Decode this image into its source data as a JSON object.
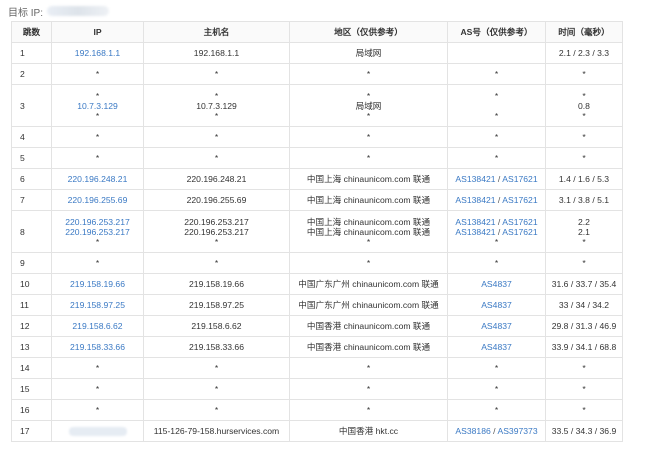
{
  "target": {
    "label": "目标 IP:"
  },
  "columns": [
    "跳数",
    "IP",
    "主机名",
    "地区（仅供参考）",
    "AS号（仅供参考）",
    "时间（毫秒）"
  ],
  "rows": [
    {
      "hop": "1",
      "ips": [
        "192.168.1.1"
      ],
      "hosts": [
        "192.168.1.1"
      ],
      "regions": [
        "局域网"
      ],
      "as": [
        []
      ],
      "times": [
        "2.1 / 2.3 / 3.3"
      ]
    },
    {
      "hop": "2",
      "ips": [
        "*"
      ],
      "hosts": [
        "*"
      ],
      "regions": [
        "*"
      ],
      "as": [
        [
          "*"
        ]
      ],
      "times": [
        "*"
      ]
    },
    {
      "hop": "3",
      "ips": [
        "*",
        "10.7.3.129",
        "*"
      ],
      "hosts": [
        "*",
        "10.7.3.129",
        "*"
      ],
      "regions": [
        "*",
        "局域网",
        "*"
      ],
      "as": [
        [
          "*"
        ],
        [],
        [
          "*"
        ]
      ],
      "times": [
        "*",
        "0.8",
        "*"
      ]
    },
    {
      "hop": "4",
      "ips": [
        "*"
      ],
      "hosts": [
        "*"
      ],
      "regions": [
        "*"
      ],
      "as": [
        [
          "*"
        ]
      ],
      "times": [
        "*"
      ]
    },
    {
      "hop": "5",
      "ips": [
        "*"
      ],
      "hosts": [
        "*"
      ],
      "regions": [
        "*"
      ],
      "as": [
        [
          "*"
        ]
      ],
      "times": [
        "*"
      ]
    },
    {
      "hop": "6",
      "ips": [
        "220.196.248.21"
      ],
      "hosts": [
        "220.196.248.21"
      ],
      "regions": [
        "中国上海 chinaunicom.com 联通"
      ],
      "as": [
        [
          "AS138421",
          "AS17621"
        ]
      ],
      "times": [
        "1.4 / 1.6 / 5.3"
      ]
    },
    {
      "hop": "7",
      "ips": [
        "220.196.255.69"
      ],
      "hosts": [
        "220.196.255.69"
      ],
      "regions": [
        "中国上海 chinaunicom.com 联通"
      ],
      "as": [
        [
          "AS138421",
          "AS17621"
        ]
      ],
      "times": [
        "3.1 / 3.8 / 5.1"
      ]
    },
    {
      "hop": "8",
      "ips": [
        "220.196.253.217",
        "220.196.253.217",
        "*"
      ],
      "hosts": [
        "220.196.253.217",
        "220.196.253.217",
        "*"
      ],
      "regions": [
        "中国上海 chinaunicom.com 联通",
        "中国上海 chinaunicom.com 联通",
        "*"
      ],
      "as": [
        [
          "AS138421",
          "AS17621"
        ],
        [
          "AS138421",
          "AS17621"
        ],
        [
          "*"
        ]
      ],
      "times": [
        "2.2",
        "2.1",
        "*"
      ]
    },
    {
      "hop": "9",
      "ips": [
        "*"
      ],
      "hosts": [
        "*"
      ],
      "regions": [
        "*"
      ],
      "as": [
        [
          "*"
        ]
      ],
      "times": [
        "*"
      ]
    },
    {
      "hop": "10",
      "ips": [
        "219.158.19.66"
      ],
      "hosts": [
        "219.158.19.66"
      ],
      "regions": [
        "中国广东广州 chinaunicom.com 联通"
      ],
      "as": [
        [
          "AS4837"
        ]
      ],
      "times": [
        "31.6 / 33.7 / 35.4"
      ]
    },
    {
      "hop": "11",
      "ips": [
        "219.158.97.25"
      ],
      "hosts": [
        "219.158.97.25"
      ],
      "regions": [
        "中国广东广州 chinaunicom.com 联通"
      ],
      "as": [
        [
          "AS4837"
        ]
      ],
      "times": [
        "33 / 34 / 34.2"
      ]
    },
    {
      "hop": "12",
      "ips": [
        "219.158.6.62"
      ],
      "hosts": [
        "219.158.6.62"
      ],
      "regions": [
        "中国香港 chinaunicom.com 联通"
      ],
      "as": [
        [
          "AS4837"
        ]
      ],
      "times": [
        "29.8 / 31.3 / 46.9"
      ]
    },
    {
      "hop": "13",
      "ips": [
        "219.158.33.66"
      ],
      "hosts": [
        "219.158.33.66"
      ],
      "regions": [
        "中国香港 chinaunicom.com 联通"
      ],
      "as": [
        [
          "AS4837"
        ]
      ],
      "times": [
        "33.9 / 34.1 / 68.8"
      ]
    },
    {
      "hop": "14",
      "ips": [
        "*"
      ],
      "hosts": [
        "*"
      ],
      "regions": [
        "*"
      ],
      "as": [
        [
          "*"
        ]
      ],
      "times": [
        "*"
      ]
    },
    {
      "hop": "15",
      "ips": [
        "*"
      ],
      "hosts": [
        "*"
      ],
      "regions": [
        "*"
      ],
      "as": [
        [
          "*"
        ]
      ],
      "times": [
        "*"
      ]
    },
    {
      "hop": "16",
      "ips": [
        "*"
      ],
      "hosts": [
        "*"
      ],
      "regions": [
        "*"
      ],
      "as": [
        [
          "*"
        ]
      ],
      "times": [
        "*"
      ]
    },
    {
      "hop": "17",
      "ips": [
        ""
      ],
      "hosts": [
        "115-126-79-158.hurservices.com"
      ],
      "regions": [
        "中国香港 hkt.cc"
      ],
      "as": [
        [
          "AS38186",
          "AS397373"
        ]
      ],
      "times": [
        "33.5 / 34.3 / 36.9"
      ]
    }
  ]
}
